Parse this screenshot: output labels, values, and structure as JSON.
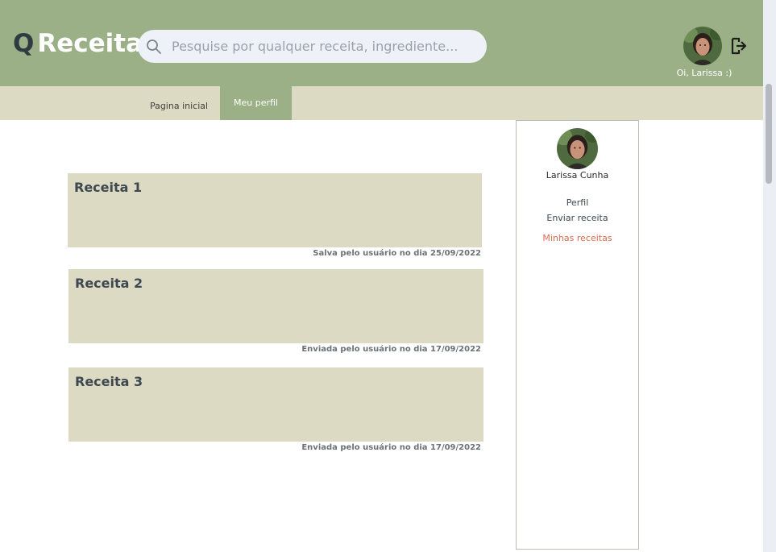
{
  "header": {
    "logo_letter": "Q",
    "logo_text": "Receita",
    "search_placeholder": "Pesquise por qualquer receita, ingrediente...",
    "greeting": "Oi, Larissa :)"
  },
  "nav": {
    "tabs": [
      {
        "label": "Pagina inicial",
        "active": false
      },
      {
        "label": "Meu perfil",
        "active": true
      }
    ]
  },
  "recipes": [
    {
      "title": "Receita 1",
      "meta": "Salva pelo usuário no dia 25/09/2022"
    },
    {
      "title": "Receita 2",
      "meta": "Enviada pelo usuário no dia 17/09/2022"
    },
    {
      "title": "Receita 3",
      "meta": "Enviada pelo usuário no dia 17/09/2022"
    }
  ],
  "profile_panel": {
    "name": "Larissa Cunha",
    "links": [
      {
        "label": "Perfil",
        "active": false
      },
      {
        "label": "Enviar receita",
        "active": false
      },
      {
        "label": "Minhas receitas",
        "active": true
      }
    ]
  },
  "colors": {
    "header_bg": "#9bb086",
    "nav_bg": "#dcdac3",
    "card_bg": "#dcdac3",
    "active_link": "#d86b4e"
  },
  "icons": {
    "search": "search-icon",
    "logout": "logout-icon",
    "avatar": "user-avatar"
  }
}
